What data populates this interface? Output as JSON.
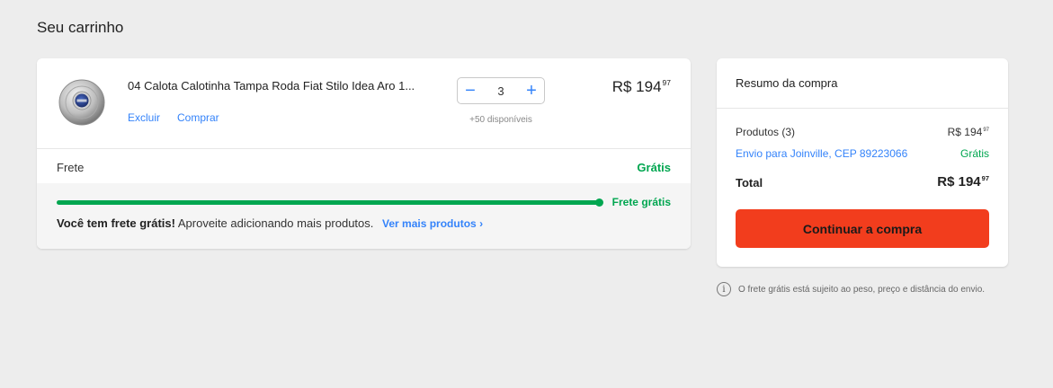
{
  "page": {
    "title": "Seu carrinho"
  },
  "item": {
    "title": "04 Calota Calotinha Tampa Roda Fiat Stilo Idea Aro 1...",
    "remove_label": "Excluir",
    "buy_label": "Comprar",
    "quantity": "3",
    "minus_symbol": "−",
    "plus_symbol": "+",
    "stock": "+50 disponíveis",
    "price_main": "R$ 194",
    "price_cents": "97",
    "thumbnail_icon": "fiat-hubcap-icon"
  },
  "shipping": {
    "label": "Frete",
    "value": "Grátis"
  },
  "free_shipping": {
    "progress_percent": 100,
    "progress_label": "Frete grátis",
    "message_bold": "Você tem frete grátis!",
    "message_rest": " Aproveite adicionando mais produtos.",
    "link_label": "Ver mais produtos",
    "link_chevron": "›"
  },
  "summary": {
    "title": "Resumo da compra",
    "products_label": "Produtos (3)",
    "products_price_main": "R$ 194",
    "products_price_cents": "97",
    "shipping_label": "Envio para Joinville, CEP 89223066",
    "shipping_value": "Grátis",
    "total_label": "Total",
    "total_price_main": "R$ 194",
    "total_price_cents": "97",
    "cta_label": "Continuar a compra"
  },
  "disclaimer": {
    "icon": "i",
    "text": "O frete grátis está sujeito ao peso, preço e distância do envio."
  },
  "colors": {
    "accent_blue": "#3483fa",
    "success_green": "#00a650",
    "cta_red": "#f23d1d",
    "background": "#ededed"
  }
}
